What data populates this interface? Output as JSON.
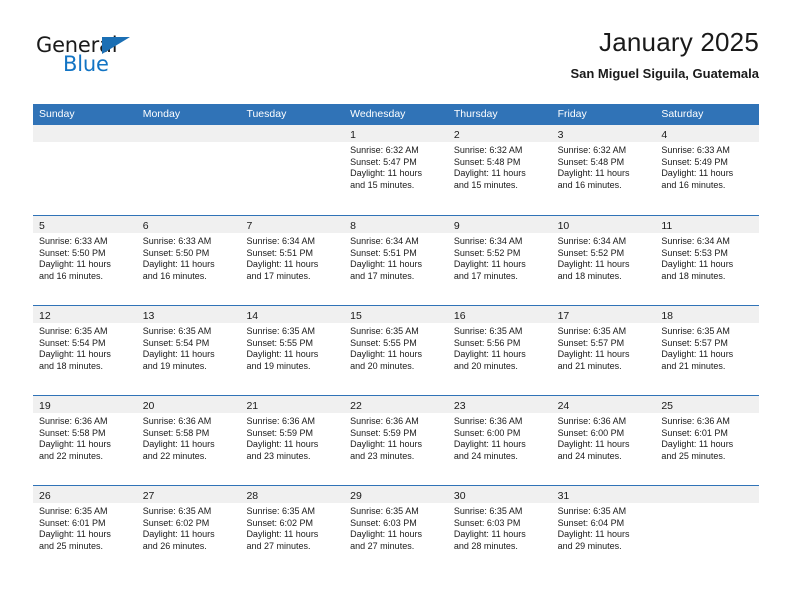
{
  "brand": {
    "name_part1": "General",
    "name_part2": "Blue",
    "accent_color": "#1274c4",
    "flag_color": "#1b6fb4"
  },
  "header": {
    "title": "January 2025",
    "subtitle": "San Miguel Siguila, Guatemala"
  },
  "theme": {
    "header_blue": "#3073b7",
    "day_band_gray": "#f0f0f0",
    "separator_blue": "#3073b7"
  },
  "weekday_headers": [
    "Sunday",
    "Monday",
    "Tuesday",
    "Wednesday",
    "Thursday",
    "Friday",
    "Saturday"
  ],
  "weeks": [
    [
      {
        "day": "",
        "empty": true,
        "lines": []
      },
      {
        "day": "",
        "empty": true,
        "lines": []
      },
      {
        "day": "",
        "empty": true,
        "lines": []
      },
      {
        "day": "1",
        "empty": false,
        "lines": [
          "Sunrise: 6:32 AM",
          "Sunset: 5:47 PM",
          "Daylight: 11 hours",
          "and 15 minutes."
        ]
      },
      {
        "day": "2",
        "empty": false,
        "lines": [
          "Sunrise: 6:32 AM",
          "Sunset: 5:48 PM",
          "Daylight: 11 hours",
          "and 15 minutes."
        ]
      },
      {
        "day": "3",
        "empty": false,
        "lines": [
          "Sunrise: 6:32 AM",
          "Sunset: 5:48 PM",
          "Daylight: 11 hours",
          "and 16 minutes."
        ]
      },
      {
        "day": "4",
        "empty": false,
        "lines": [
          "Sunrise: 6:33 AM",
          "Sunset: 5:49 PM",
          "Daylight: 11 hours",
          "and 16 minutes."
        ]
      }
    ],
    [
      {
        "day": "5",
        "empty": false,
        "lines": [
          "Sunrise: 6:33 AM",
          "Sunset: 5:50 PM",
          "Daylight: 11 hours",
          "and 16 minutes."
        ]
      },
      {
        "day": "6",
        "empty": false,
        "lines": [
          "Sunrise: 6:33 AM",
          "Sunset: 5:50 PM",
          "Daylight: 11 hours",
          "and 16 minutes."
        ]
      },
      {
        "day": "7",
        "empty": false,
        "lines": [
          "Sunrise: 6:34 AM",
          "Sunset: 5:51 PM",
          "Daylight: 11 hours",
          "and 17 minutes."
        ]
      },
      {
        "day": "8",
        "empty": false,
        "lines": [
          "Sunrise: 6:34 AM",
          "Sunset: 5:51 PM",
          "Daylight: 11 hours",
          "and 17 minutes."
        ]
      },
      {
        "day": "9",
        "empty": false,
        "lines": [
          "Sunrise: 6:34 AM",
          "Sunset: 5:52 PM",
          "Daylight: 11 hours",
          "and 17 minutes."
        ]
      },
      {
        "day": "10",
        "empty": false,
        "lines": [
          "Sunrise: 6:34 AM",
          "Sunset: 5:52 PM",
          "Daylight: 11 hours",
          "and 18 minutes."
        ]
      },
      {
        "day": "11",
        "empty": false,
        "lines": [
          "Sunrise: 6:34 AM",
          "Sunset: 5:53 PM",
          "Daylight: 11 hours",
          "and 18 minutes."
        ]
      }
    ],
    [
      {
        "day": "12",
        "empty": false,
        "lines": [
          "Sunrise: 6:35 AM",
          "Sunset: 5:54 PM",
          "Daylight: 11 hours",
          "and 18 minutes."
        ]
      },
      {
        "day": "13",
        "empty": false,
        "lines": [
          "Sunrise: 6:35 AM",
          "Sunset: 5:54 PM",
          "Daylight: 11 hours",
          "and 19 minutes."
        ]
      },
      {
        "day": "14",
        "empty": false,
        "lines": [
          "Sunrise: 6:35 AM",
          "Sunset: 5:55 PM",
          "Daylight: 11 hours",
          "and 19 minutes."
        ]
      },
      {
        "day": "15",
        "empty": false,
        "lines": [
          "Sunrise: 6:35 AM",
          "Sunset: 5:55 PM",
          "Daylight: 11 hours",
          "and 20 minutes."
        ]
      },
      {
        "day": "16",
        "empty": false,
        "lines": [
          "Sunrise: 6:35 AM",
          "Sunset: 5:56 PM",
          "Daylight: 11 hours",
          "and 20 minutes."
        ]
      },
      {
        "day": "17",
        "empty": false,
        "lines": [
          "Sunrise: 6:35 AM",
          "Sunset: 5:57 PM",
          "Daylight: 11 hours",
          "and 21 minutes."
        ]
      },
      {
        "day": "18",
        "empty": false,
        "lines": [
          "Sunrise: 6:35 AM",
          "Sunset: 5:57 PM",
          "Daylight: 11 hours",
          "and 21 minutes."
        ]
      }
    ],
    [
      {
        "day": "19",
        "empty": false,
        "lines": [
          "Sunrise: 6:36 AM",
          "Sunset: 5:58 PM",
          "Daylight: 11 hours",
          "and 22 minutes."
        ]
      },
      {
        "day": "20",
        "empty": false,
        "lines": [
          "Sunrise: 6:36 AM",
          "Sunset: 5:58 PM",
          "Daylight: 11 hours",
          "and 22 minutes."
        ]
      },
      {
        "day": "21",
        "empty": false,
        "lines": [
          "Sunrise: 6:36 AM",
          "Sunset: 5:59 PM",
          "Daylight: 11 hours",
          "and 23 minutes."
        ]
      },
      {
        "day": "22",
        "empty": false,
        "lines": [
          "Sunrise: 6:36 AM",
          "Sunset: 5:59 PM",
          "Daylight: 11 hours",
          "and 23 minutes."
        ]
      },
      {
        "day": "23",
        "empty": false,
        "lines": [
          "Sunrise: 6:36 AM",
          "Sunset: 6:00 PM",
          "Daylight: 11 hours",
          "and 24 minutes."
        ]
      },
      {
        "day": "24",
        "empty": false,
        "lines": [
          "Sunrise: 6:36 AM",
          "Sunset: 6:00 PM",
          "Daylight: 11 hours",
          "and 24 minutes."
        ]
      },
      {
        "day": "25",
        "empty": false,
        "lines": [
          "Sunrise: 6:36 AM",
          "Sunset: 6:01 PM",
          "Daylight: 11 hours",
          "and 25 minutes."
        ]
      }
    ],
    [
      {
        "day": "26",
        "empty": false,
        "lines": [
          "Sunrise: 6:35 AM",
          "Sunset: 6:01 PM",
          "Daylight: 11 hours",
          "and 25 minutes."
        ]
      },
      {
        "day": "27",
        "empty": false,
        "lines": [
          "Sunrise: 6:35 AM",
          "Sunset: 6:02 PM",
          "Daylight: 11 hours",
          "and 26 minutes."
        ]
      },
      {
        "day": "28",
        "empty": false,
        "lines": [
          "Sunrise: 6:35 AM",
          "Sunset: 6:02 PM",
          "Daylight: 11 hours",
          "and 27 minutes."
        ]
      },
      {
        "day": "29",
        "empty": false,
        "lines": [
          "Sunrise: 6:35 AM",
          "Sunset: 6:03 PM",
          "Daylight: 11 hours",
          "and 27 minutes."
        ]
      },
      {
        "day": "30",
        "empty": false,
        "lines": [
          "Sunrise: 6:35 AM",
          "Sunset: 6:03 PM",
          "Daylight: 11 hours",
          "and 28 minutes."
        ]
      },
      {
        "day": "31",
        "empty": false,
        "lines": [
          "Sunrise: 6:35 AM",
          "Sunset: 6:04 PM",
          "Daylight: 11 hours",
          "and 29 minutes."
        ]
      },
      {
        "day": "",
        "empty": true,
        "lines": []
      }
    ]
  ]
}
